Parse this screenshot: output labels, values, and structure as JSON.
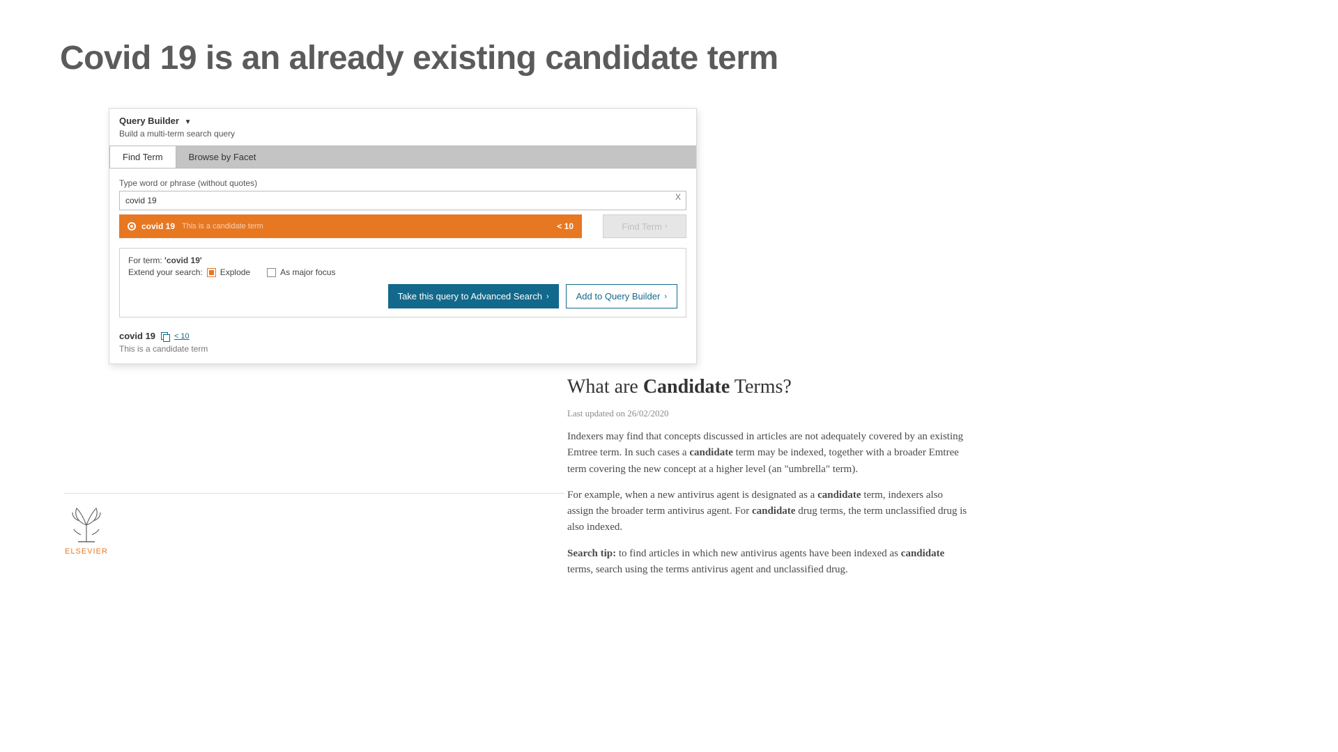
{
  "slide": {
    "title": "Covid 19 is an already existing candidate term"
  },
  "qb": {
    "title": "Query Builder",
    "subtitle": "Build a multi-term search query",
    "tabs": {
      "find": "Find Term",
      "browse": "Browse by Facet"
    },
    "type_label": "Type word or phrase (without quotes)",
    "input_value": "covid 19",
    "clear": "X",
    "suggestion": {
      "term": "covid 19",
      "note": "This is a candidate term",
      "count": "< 10"
    },
    "find_btn": "Find Term",
    "for_term_prefix": "For term: ",
    "for_term_value": "'covid 19'",
    "extend_label": "Extend your search:",
    "explode": "Explode",
    "major_focus": "As major focus",
    "advanced_btn": "Take this query to Advanced Search",
    "add_btn": "Add to Query Builder",
    "result": {
      "term": "covid 19",
      "count": "< 10",
      "note": "This is a candidate term"
    }
  },
  "explain": {
    "title_pre": "What are ",
    "title_bold": "Candidate",
    "title_post": " Terms?",
    "updated": "Last updated on 26/02/2020",
    "p1a": "Indexers may find that concepts discussed in articles are not adequately covered by an existing Emtree term. In such cases a ",
    "p1b": "candidate",
    "p1c": " term may be indexed, together with a broader Emtree term covering the new concept at a higher level (an \"umbrella\" term).",
    "p2a": "For example, when a new antivirus agent is designated as a ",
    "p2b": "candidate",
    "p2c": " term, indexers also assign the broader term antivirus agent. For ",
    "p2d": "candidate",
    "p2e": " drug terms, the term unclassified drug is also indexed.",
    "p3a": "Search tip:",
    "p3b": " to find articles in which new antivirus agents have been indexed as ",
    "p3c": "candidate",
    "p3d": " terms, search using the terms antivirus agent and unclassified drug."
  },
  "logo": {
    "text": "ELSEVIER"
  }
}
